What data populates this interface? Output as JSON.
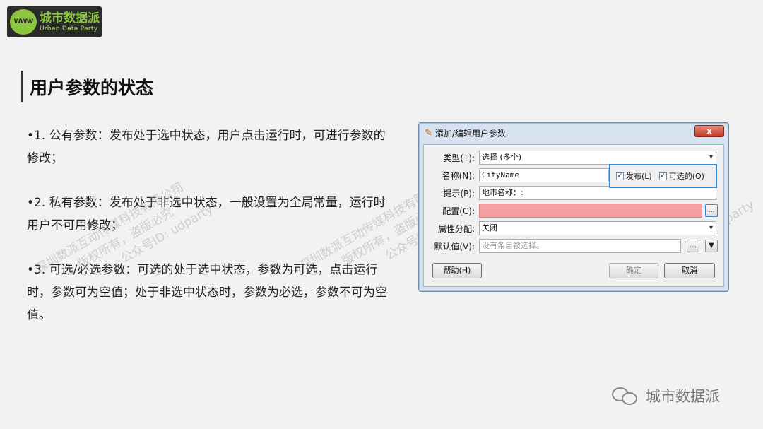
{
  "logo": {
    "badge": "WWW",
    "name_cn": "城市数据派",
    "name_en": "Urban Data Party"
  },
  "title": "用户参数的状态",
  "bullets": [
    "•1. 公有参数：发布处于选中状态，用户点击运行时，可进行参数的修改；",
    "•2. 私有参数：发布处于非选中状态，一般设置为全局常量，运行时用户不可用修改；",
    "•3. 可选/必选参数：可选的处于选中状态，参数为可选，点击运行时，参数可为空值；处于非选中状态时，参数为必选，参数不可为空值。"
  ],
  "watermark": {
    "line1": "深圳数派互动传媒科技有限公司",
    "line2": "版权所有，盗版必究",
    "line3": "公众号ID: udparty"
  },
  "dialog": {
    "title": "添加/编辑用户参数",
    "close_label": "x",
    "type_label": "类型(T):",
    "type_value": "选择 (多个)",
    "name_label": "名称(N):",
    "name_value": "CityName",
    "publish_label": "发布(L)",
    "publish_checked": "✓",
    "optional_label": "可选的(O)",
    "optional_checked": "✓",
    "prompt_label": "提示(P):",
    "prompt_value": "地市名称：:",
    "config_label": "配置(C):",
    "attr_label": "属性分配:",
    "attr_value": "关闭",
    "default_label": "默认值(V):",
    "default_placeholder": "没有条目被选择。",
    "ellipsis": "...",
    "help_button": "帮助(H)",
    "ok_button": "确定",
    "cancel_button": "取消"
  },
  "footer": {
    "name": "城市数据派"
  }
}
